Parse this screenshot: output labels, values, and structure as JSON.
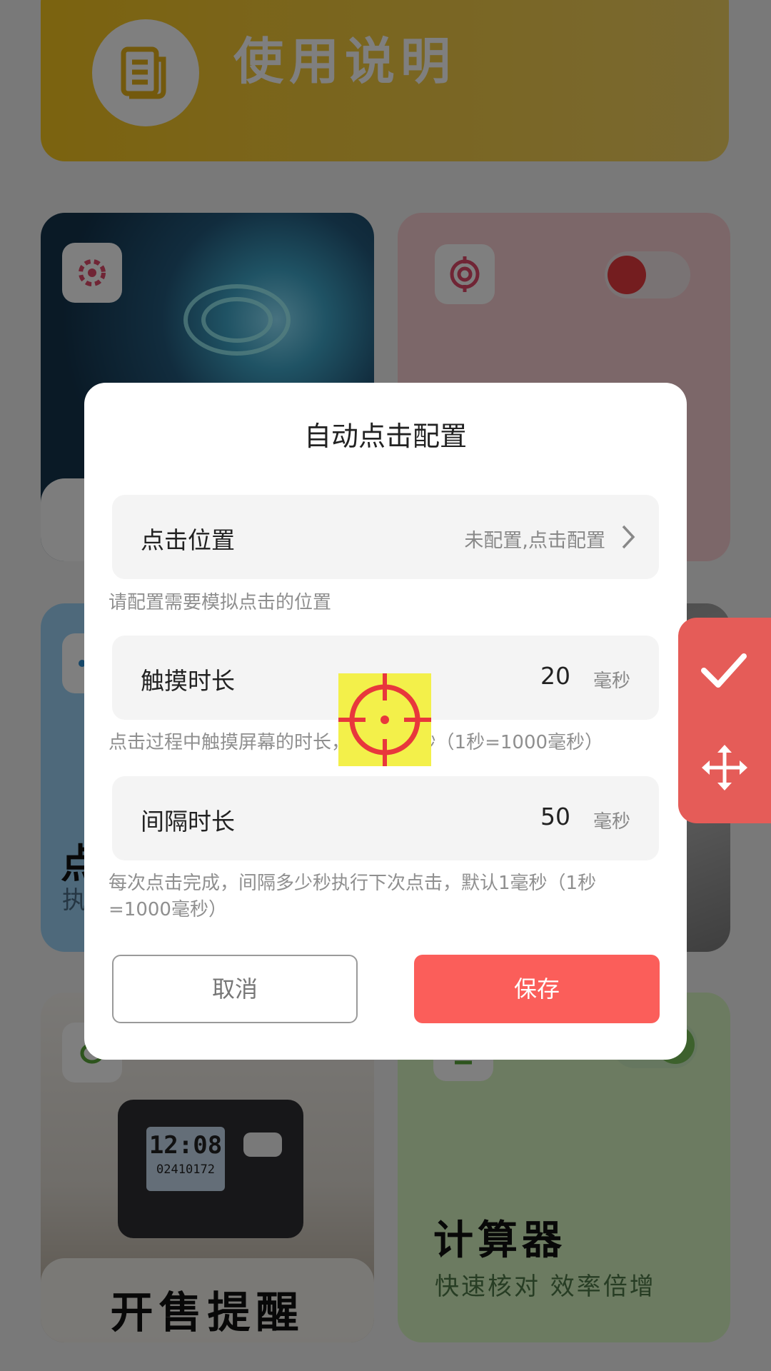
{
  "background": {
    "guide_card": {
      "title": "使用说明",
      "icon": "document-icon"
    },
    "tile_game": {
      "icon": "gear-cursor-icon"
    },
    "tile_target": {
      "icon": "target-icon",
      "toggle_on": true
    },
    "tile_blue": {
      "title_partial": "点",
      "subtitle_partial": "执"
    },
    "tile_clock": {
      "clock_time": "12:08",
      "clock_date": "02410172",
      "label": "开售提醒"
    },
    "tile_calc": {
      "title": "计算器",
      "subtitle": "快速核对 效率倍增"
    }
  },
  "dialog": {
    "title": "自动点击配置",
    "click_position": {
      "label": "点击位置",
      "value": "未配置,点击配置",
      "hint": "请配置需要模拟点击的位置"
    },
    "touch_duration": {
      "label": "触摸时长",
      "value": "20",
      "unit": "毫秒",
      "hint": "点击过程中触摸屏幕的时长，默认1毫秒（1秒=1000毫秒）"
    },
    "interval_duration": {
      "label": "间隔时长",
      "value": "50",
      "unit": "毫秒",
      "hint_line1": "每次点击完成，间隔多少秒执行下次点击，默认1毫秒（1秒",
      "hint_line2": "=1000毫秒）"
    },
    "cancel_label": "取消",
    "save_label": "保存"
  },
  "float_panel": {
    "confirm_icon": "check-icon",
    "move_icon": "move-icon"
  },
  "colors": {
    "accent": "#fb5e5a",
    "float_panel": "#e55c58",
    "target": "#e8373c",
    "target_bg": "#f3f04a"
  }
}
